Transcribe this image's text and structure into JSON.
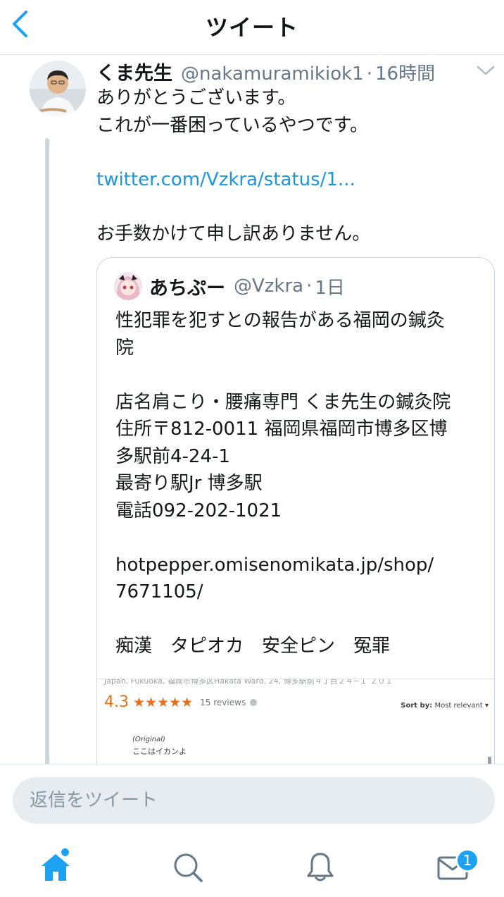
{
  "header": {
    "title": "ツイート"
  },
  "tweet": {
    "author_name": "くま先生",
    "author_handle": "@nakamuramikiok1",
    "separator": "·",
    "time": "16時間",
    "lines": [
      "ありがとうございます。",
      "これが一番困っているやつです。",
      "",
      "twitter.com/Vzkra/status/1...",
      "",
      "お手数かけて申し訳ありません。"
    ]
  },
  "quote": {
    "author_name": "あちぷー",
    "author_handle": "@Vzkra",
    "separator": "·",
    "time": "1日",
    "lines": [
      "性犯罪を犯すとの報告がある福岡の鍼灸",
      "院",
      "",
      "店名肩こり・腰痛専門 くま先生の鍼灸院",
      "住所〒812-0011 福岡県福岡市博多区博",
      "多駅前4-24-1",
      "最寄り駅Jr 博多駅",
      "電話092-202-1021",
      "",
      "hotpepper.omisenomikata.jp/shop/",
      "7671105/",
      "",
      "痴漢　タピオカ　安全ピン　冤罪"
    ],
    "image": {
      "address_strip": "Japan, Fukuoka, 福岡市博多区Hakata Ward, 24, 博多駅前４丁目２４−１ ２０１",
      "rating": "4.3",
      "stars": "★★★★★",
      "stars_value": 4.3,
      "reviews": "15 reviews",
      "sort_label": "Sort by:",
      "sort_value": "Most relevant",
      "original_label": "(Original)",
      "original_text": "ここはイカンよ"
    }
  },
  "reply": {
    "placeholder": "返信をツイート"
  },
  "tabbar": {
    "messages_badge": "1"
  },
  "colors": {
    "accent": "#1da1f2",
    "link": "#1b95e0",
    "muted": "#657786",
    "rating": "#e7711b"
  }
}
